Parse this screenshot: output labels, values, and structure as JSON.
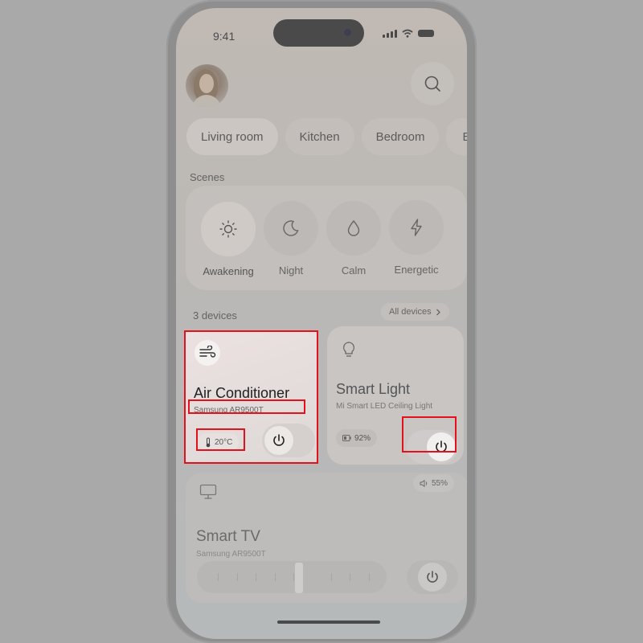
{
  "status_bar": {
    "time": "9:41"
  },
  "rooms": {
    "tabs": [
      {
        "label": "Living room"
      },
      {
        "label": "Kitchen"
      },
      {
        "label": "Bedroom"
      },
      {
        "label": "B"
      }
    ]
  },
  "scenes": {
    "title": "Scenes",
    "items": [
      {
        "label": "Awakening",
        "icon": "sun-icon",
        "selected": true
      },
      {
        "label": "Night",
        "icon": "moon-icon",
        "selected": false
      },
      {
        "label": "Calm",
        "icon": "drop-icon",
        "selected": false
      },
      {
        "label": "Energetic",
        "icon": "lightning-icon",
        "selected": false
      }
    ]
  },
  "devices": {
    "count_label": "3 devices",
    "all_devices_label": "All devices",
    "air_conditioner": {
      "name": "Air Conditioner",
      "model": "Samsung AR9500T",
      "temperature": "20°C",
      "icon": "wind-icon",
      "power": "off"
    },
    "smart_light": {
      "name": "Smart Light",
      "model": "Mi Smart LED Ceiling Light",
      "brightness": "92%",
      "icon": "bulb-icon",
      "power": "on"
    },
    "smart_tv": {
      "name": "Smart TV",
      "model": "Samsung AR9500T",
      "volume": "55%",
      "icon": "monitor-icon",
      "power": "on"
    }
  },
  "colors": {
    "highlight": "#e3111b",
    "accent_dark": "#222222"
  }
}
